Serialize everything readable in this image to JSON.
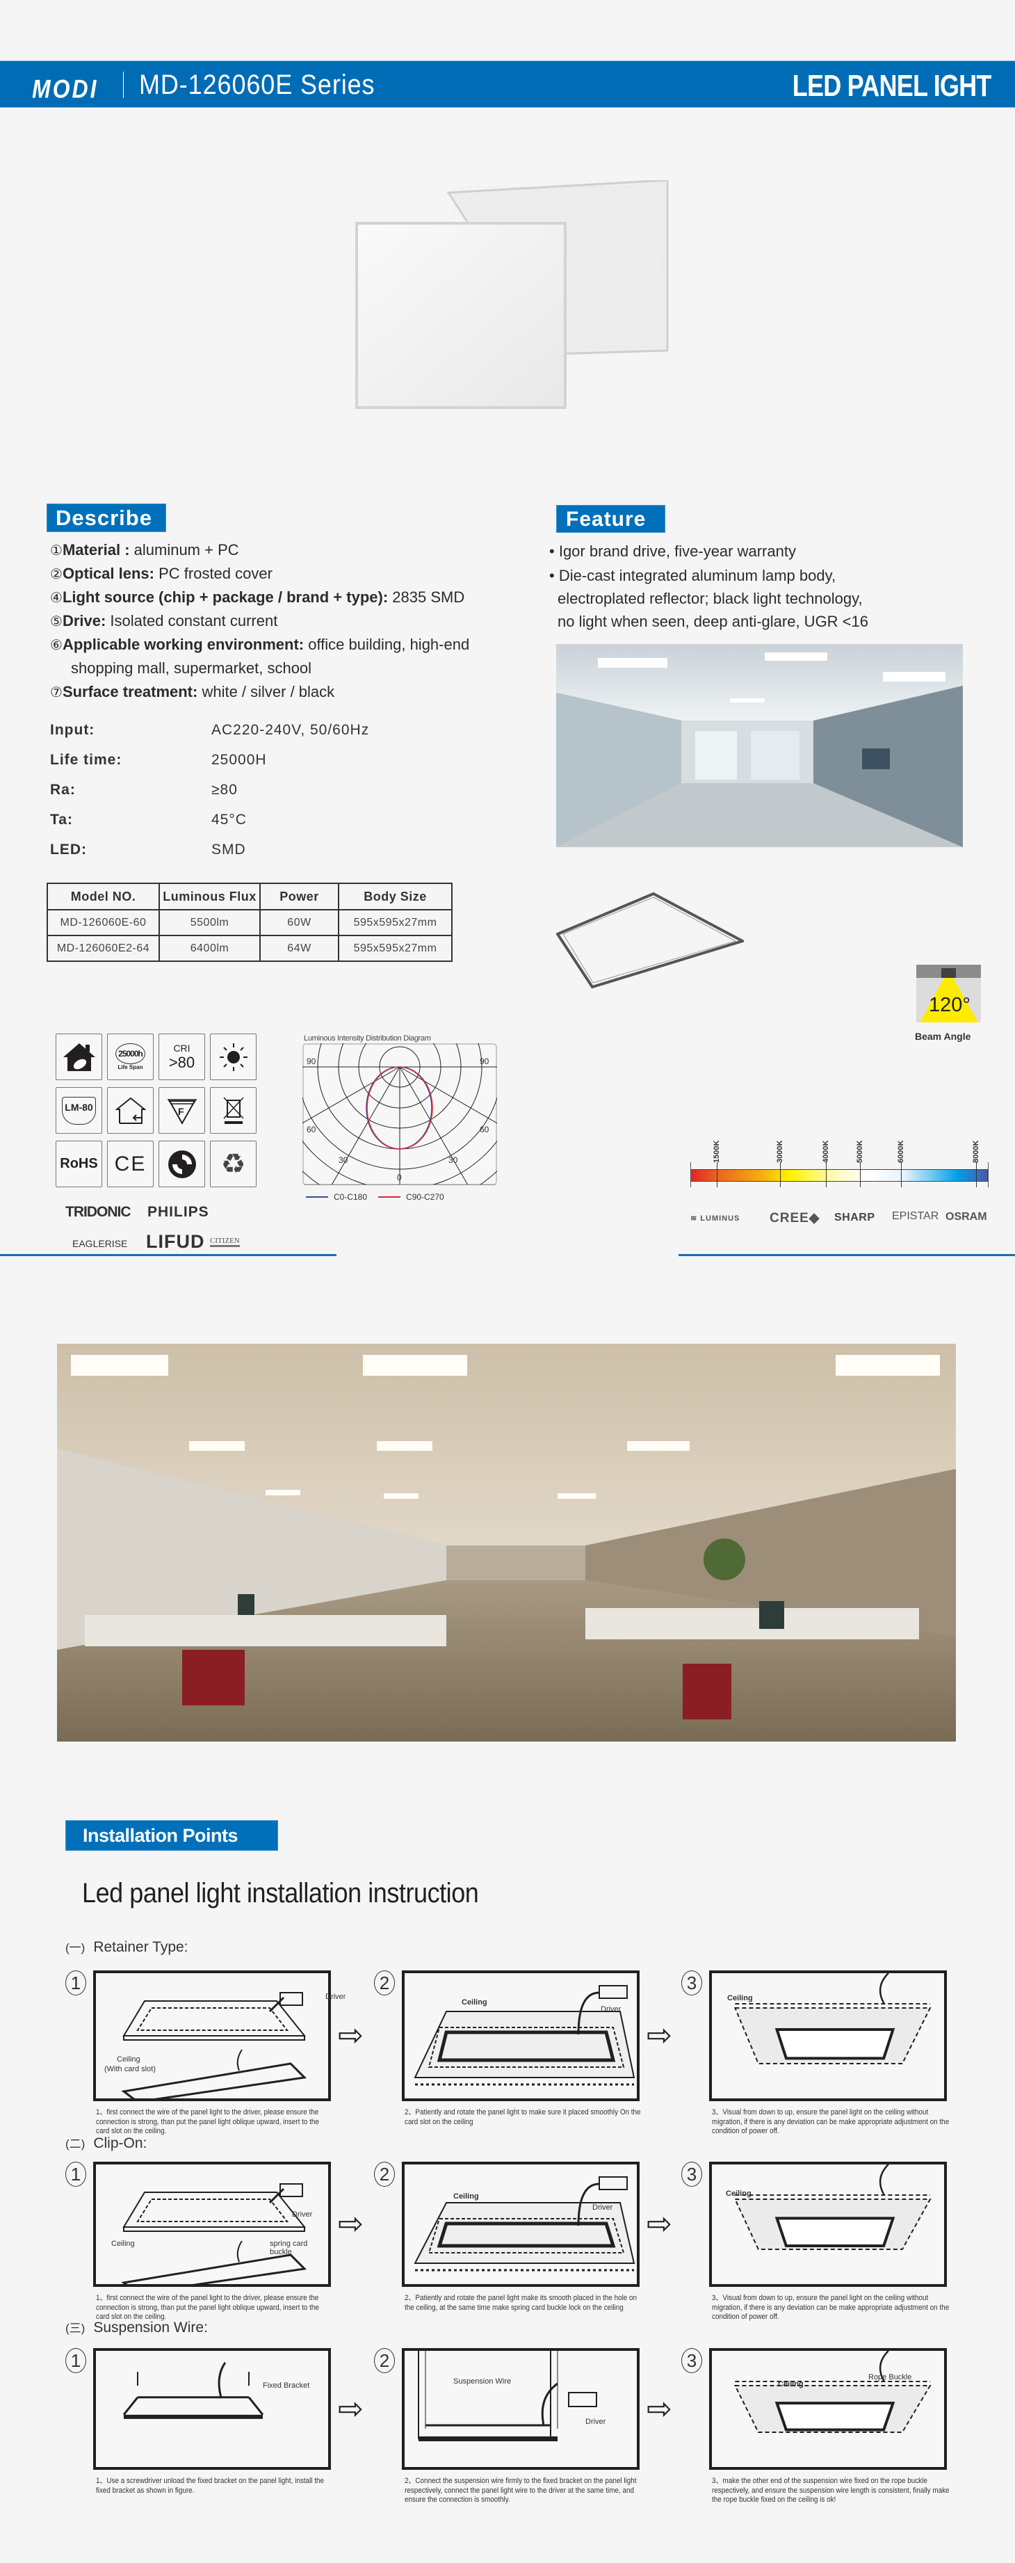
{
  "header": {
    "brand": "MODI",
    "series": "MD-126060E Series",
    "category": "LED PANEL IGHT",
    "accent": "#006cb5"
  },
  "describe": {
    "title": "Describe",
    "items": [
      {
        "num": "①",
        "label": "Material :",
        "value": " aluminum + PC"
      },
      {
        "num": "②",
        "label": "Optical lens:",
        "value": " PC frosted cover"
      },
      {
        "num": "④",
        "label": "Light source (chip + package / brand + type):",
        "value": " 2835 SMD"
      },
      {
        "num": "⑤",
        "label": "Drive:",
        "value": " Isolated constant current"
      },
      {
        "num": "⑥",
        "label": "Applicable working environment:",
        "value": " office building, high-end",
        "cont": "shopping mall, supermarket, school"
      },
      {
        "num": "⑦",
        "label": "Surface treatment:",
        "value": " white / silver / black"
      }
    ],
    "specs": [
      {
        "label": "Input:",
        "value": "AC220-240V, 50/60Hz"
      },
      {
        "label": "Life time:",
        "value": "25000H"
      },
      {
        "label": "Ra:",
        "value": "≥80"
      },
      {
        "label": "Ta:",
        "value": "45°C"
      },
      {
        "label": "LED:",
        "value": "SMD"
      }
    ],
    "table": {
      "headers": [
        "Model NO.",
        "Luminous Flux",
        "Power",
        "Body Size"
      ],
      "rows": [
        [
          "MD-126060E-60",
          "5500lm",
          "60W",
          "595x595x27mm"
        ],
        [
          "MD-126060E2-64",
          "6400lm",
          "64W",
          "595x595x27mm"
        ]
      ]
    }
  },
  "feature": {
    "title": "Feature",
    "bullets": [
      "Igor brand drive, five-year warranty",
      "Die-cast integrated aluminum lamp body,",
      "electroplated reflector; black light technology,",
      "no light when seen, deep anti-glare, UGR <16"
    ]
  },
  "certifications": {
    "life_value": "25000h",
    "life_label": "Life Span",
    "cri_label": "CRI",
    "cri_value": ">80",
    "lm80": "LM-80",
    "rohs": "RoHS",
    "ce": "CE",
    "icons": [
      "eco-house-icon",
      "lifespan-icon",
      "cri-icon",
      "sun-icon",
      "lm80-shield-icon",
      "indoor-house-icon",
      "f-mark-icon",
      "weee-bin-icon",
      "rohs-icon",
      "ce-mark-icon",
      "green-dot-icon",
      "recycle-icon"
    ]
  },
  "polar": {
    "title": "Luminous Intensity Distribution Diagram",
    "angle_labels": [
      "90",
      "90",
      "60",
      "60",
      "30",
      "30",
      "0"
    ],
    "legend": [
      {
        "name": "C0-C180",
        "color": "#2b4a9b"
      },
      {
        "name": "C90-C270",
        "color": "#d42a3a"
      }
    ]
  },
  "driver_brands": [
    "TRIDONIC",
    "PHILIPS",
    "EAGLERISE",
    "LIFUD",
    "CITIZEN"
  ],
  "beam": {
    "value": "120°",
    "label": "Beam Angle"
  },
  "cct": {
    "ticks": [
      "1500K",
      "3000K",
      "4000K",
      "5000K",
      "6000K",
      "8000K"
    ]
  },
  "chip_brands": [
    "LUMINUS",
    "CREE",
    "SHARP",
    "EPISTAR",
    "OSRAM"
  ],
  "installation": {
    "tag": "Installation Points",
    "title": "Led panel light installation instruction",
    "sections": [
      {
        "marker": "(一)",
        "title": "Retainer Type:",
        "steps": [
          {
            "num": "1",
            "labels": [
              "Driver",
              "Ceiling",
              "(With card slot)"
            ],
            "caption": "1、first connect the wire of the panel light to the driver, please ensure the connection is strong, than put the panel light oblique upward, insert to the card slot on the ceiling."
          },
          {
            "num": "2",
            "labels": [
              "Ceiling",
              "Driver"
            ],
            "caption": "2、Patiently and rotate the panel light to make sure it placed smoothly On the card slot on the ceiling"
          },
          {
            "num": "3",
            "labels": [
              "Ceiling"
            ],
            "caption": "3、Visual from down to up, ensure the panel light on the ceiling without migration, if there is any deviation can be make appropriate adjustment on the condition of power off."
          }
        ]
      },
      {
        "marker": "(二)",
        "title": "Clip-On:",
        "steps": [
          {
            "num": "1",
            "labels": [
              "Driver",
              "Ceiling",
              "spring card buckle"
            ],
            "caption": "1、first connect the wire of the panel light to the driver, please ensure the connection is strong, than put the panel light oblique upward, insert to the card slot on the ceiling."
          },
          {
            "num": "2",
            "labels": [
              "Ceiling",
              "Driver"
            ],
            "caption": "2、Patiently and rotate the panel light make its smooth placed in the hole on the ceiling, at the same time make spring card buckle lock on the ceiling"
          },
          {
            "num": "3",
            "labels": [
              "Ceiling"
            ],
            "caption": "3、Visual from down to up, ensure the panel light on the ceiling without migration, if there is any deviation can be make appropriate adjustment on the condition of power off."
          }
        ]
      },
      {
        "marker": "(三)",
        "title": "Suspension Wire:",
        "steps": [
          {
            "num": "1",
            "labels": [
              "Fixed Bracket"
            ],
            "caption": "1、Use a screwdriver unload the fixed bracket on the panel light, install the fixed bracket as shown in figure."
          },
          {
            "num": "2",
            "labels": [
              "Suspension Wire",
              "Driver"
            ],
            "caption": "2、Connect the suspension wire firmly to the fixed bracket on the panel light respectively, connect the panel light wire to the driver at the same time, and ensure the connection is smoothly."
          },
          {
            "num": "3",
            "labels": [
              "Ceiling",
              "Rope Buckle"
            ],
            "caption": "3、make the other end of the suspension wire fixed on the rope buckle respectively, and ensure the suspension wire length is consistent, finally make the rope buckle fixed on the ceiling is ok!"
          }
        ]
      }
    ]
  }
}
